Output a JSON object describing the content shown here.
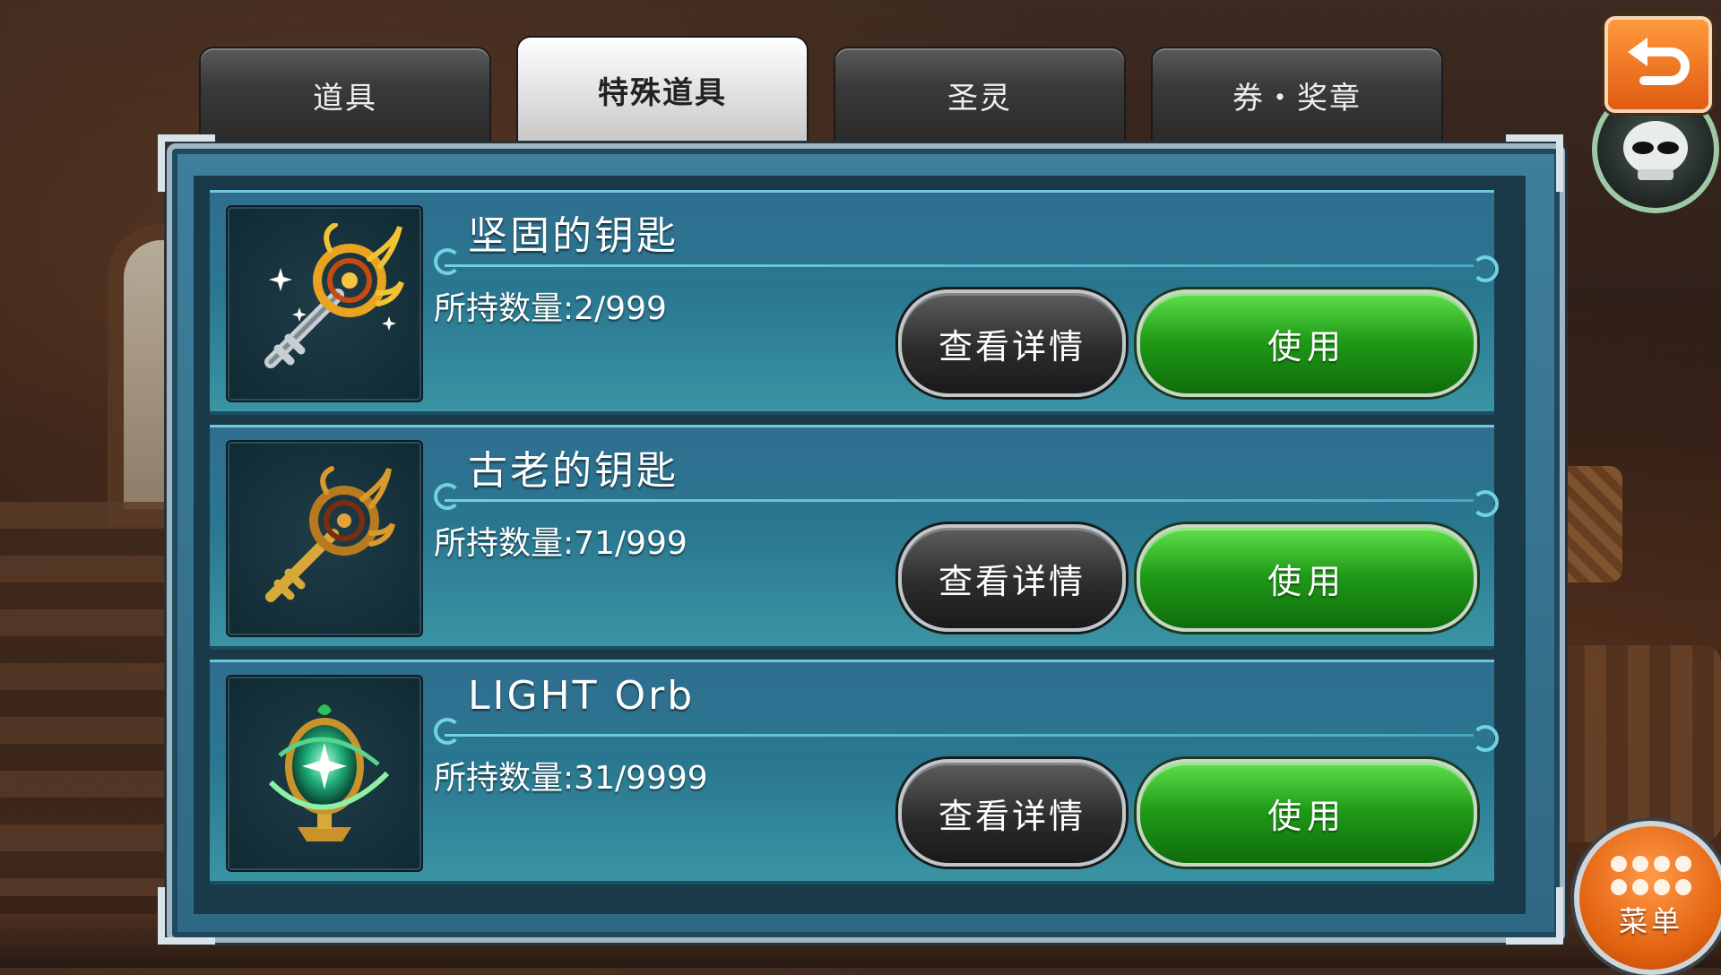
{
  "tabs": [
    {
      "label": "道具"
    },
    {
      "label": "特殊道具",
      "active": true
    },
    {
      "label": "圣灵"
    },
    {
      "label": "券・奖章"
    }
  ],
  "items": [
    {
      "name": "坚固的钥匙",
      "quantity": "所持数量:2/999",
      "icon": "silver-gold-key-icon"
    },
    {
      "name": "古老的钥匙",
      "quantity": "所持数量:71/999",
      "icon": "gold-key-icon"
    },
    {
      "name": "LIGHT Orb",
      "quantity": "所持数量:31/9999",
      "icon": "green-orb-icon"
    }
  ],
  "buttons": {
    "detail_label": "查看详情",
    "use_label": "使用"
  },
  "menu": {
    "label": "菜单"
  },
  "colors": {
    "panel": "#2f6882",
    "use_button": "#1f9a17",
    "detail_button": "#2c2c2c",
    "accent_orange": "#e05a12"
  }
}
